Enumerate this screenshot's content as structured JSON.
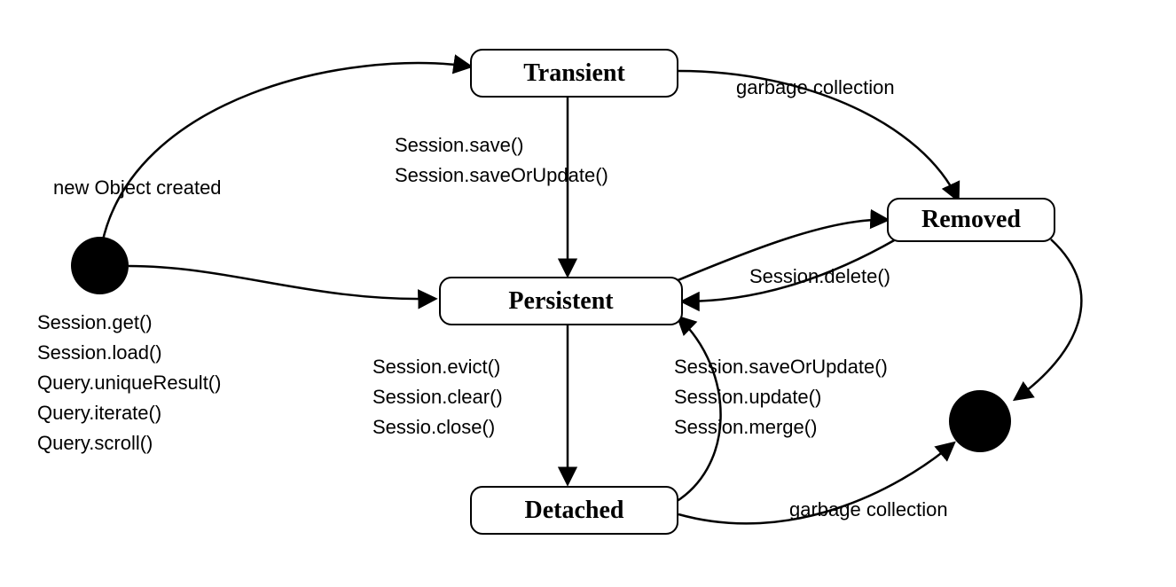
{
  "states": {
    "transient": "Transient",
    "persistent": "Persistent",
    "detached": "Detached",
    "removed": "Removed"
  },
  "labels": {
    "new_object": "new Object created",
    "garbage_collection_top": "garbage collection",
    "garbage_collection_bottom": "garbage collection",
    "session_delete": "Session.delete()",
    "transient_to_persistent_1": "Session.save()",
    "transient_to_persistent_2": "Session.saveOrUpdate()",
    "persistent_to_detached_1": "Session.evict()",
    "persistent_to_detached_2": "Session.clear()",
    "persistent_to_detached_3": "Sessio.close()",
    "detached_to_persistent_1": "Session.saveOrUpdate()",
    "detached_to_persistent_2": "Session.update()",
    "detached_to_persistent_3": "Session.merge()",
    "initial_methods_1": "Session.get()",
    "initial_methods_2": "Session.load()",
    "initial_methods_3": "Query.uniqueResult()",
    "initial_methods_4": "Query.iterate()",
    "initial_methods_5": "Query.scroll()"
  }
}
